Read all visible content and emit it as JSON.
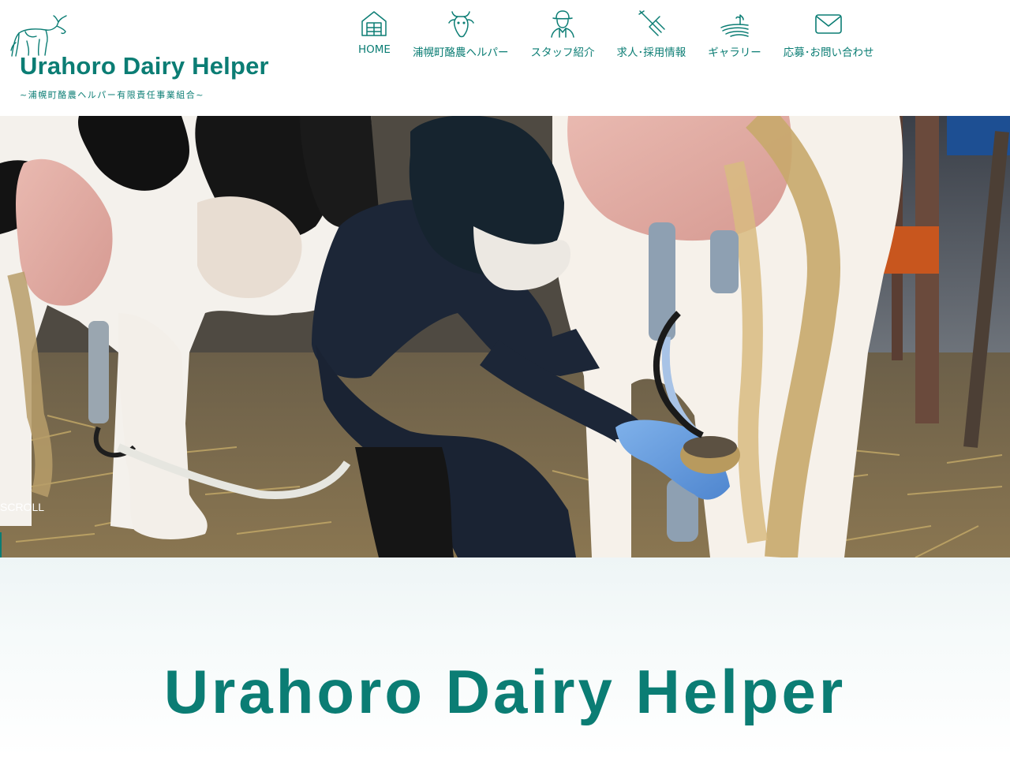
{
  "header": {
    "logo_title": "Urahoro Dairy Helper",
    "logo_subtitle": "~浦幌町酪農ヘルパー有限責任事業組合~"
  },
  "nav": {
    "items": [
      {
        "label": "HOME",
        "icon": "house-icon"
      },
      {
        "label": "浦幌町酪農ヘルパー",
        "icon": "cow-head-icon"
      },
      {
        "label": "スタッフ紹介",
        "icon": "farmer-icon"
      },
      {
        "label": "求人･採用情報",
        "icon": "pitchfork-icon"
      },
      {
        "label": "ギャラリー",
        "icon": "field-icon"
      },
      {
        "label": "応募･お問い合わせ",
        "icon": "envelope-icon"
      }
    ]
  },
  "hero": {
    "scroll_label": "SCROLL"
  },
  "intro": {
    "title": "Urahoro Dairy Helper"
  },
  "colors": {
    "brand": "#0b7d74",
    "white": "#ffffff"
  }
}
